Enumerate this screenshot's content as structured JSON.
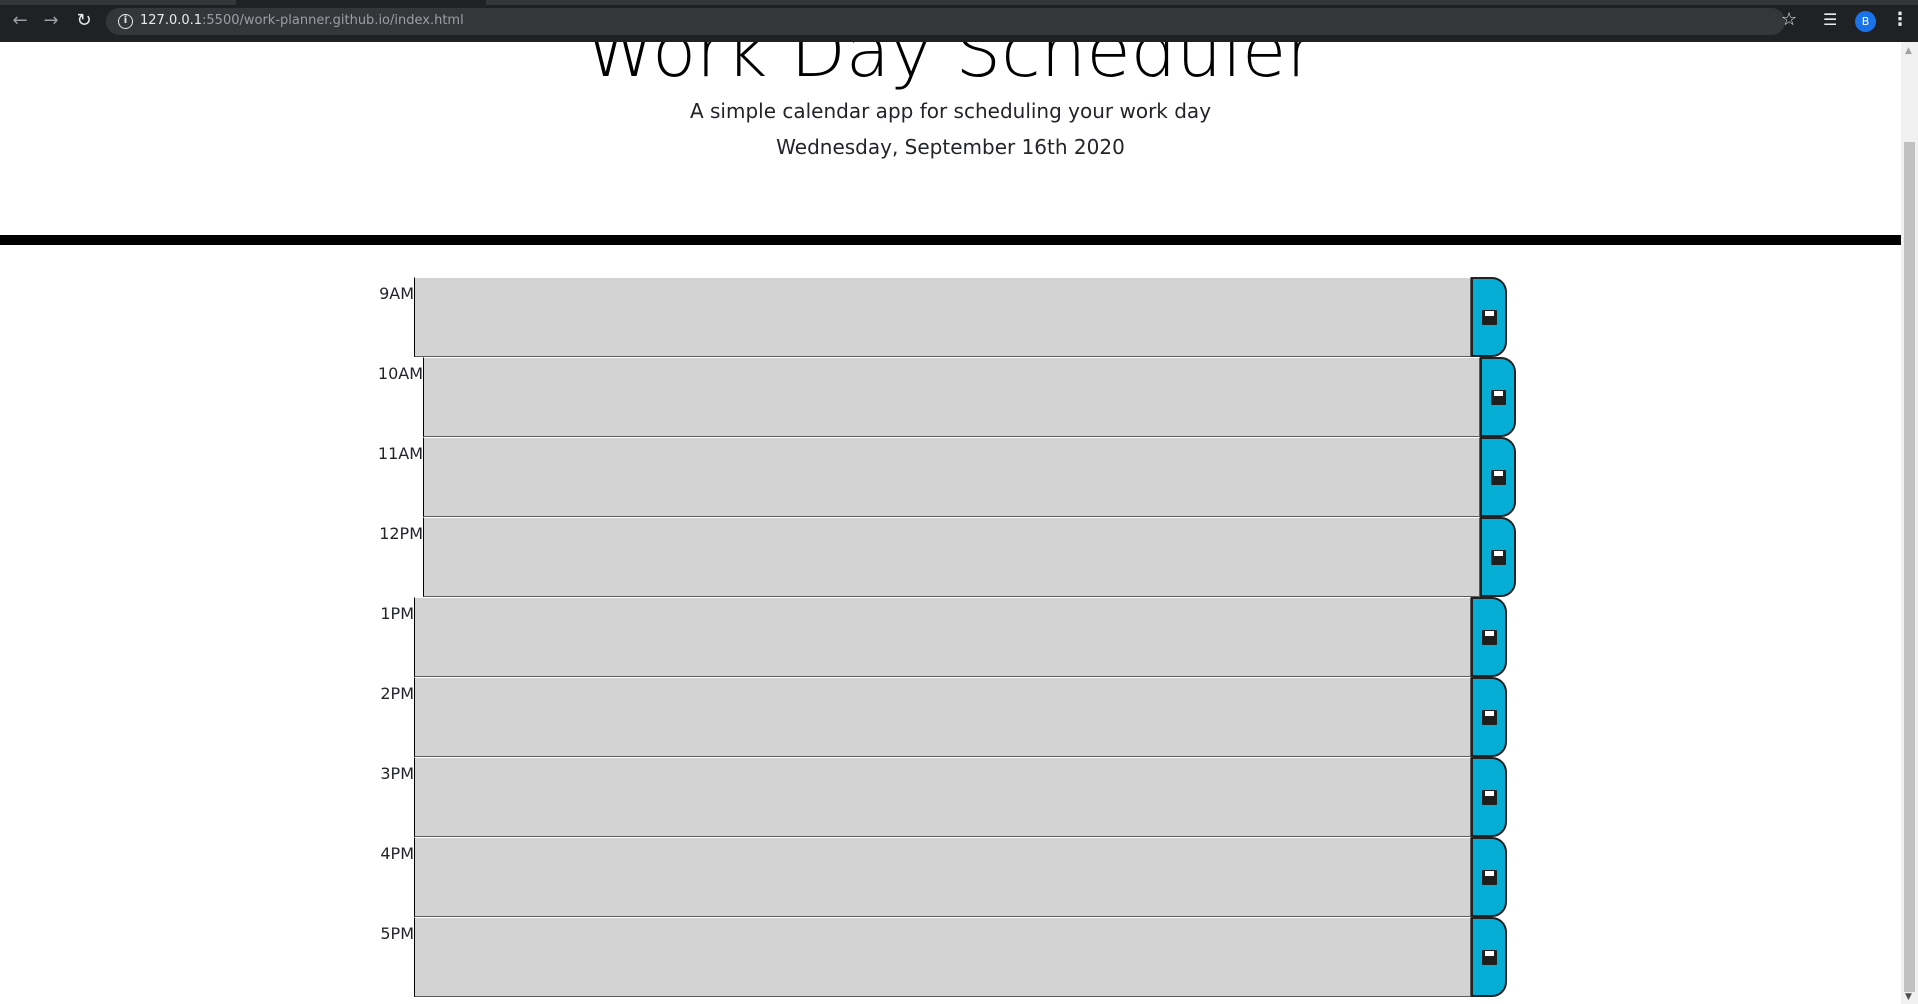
{
  "browser": {
    "url_host": "127.0.0.1",
    "url_rest": ":5500/work-planner.github.io/index.html",
    "avatar_letter": "B"
  },
  "header": {
    "title": "Work Day Scheduler",
    "lead": "A simple calendar app for scheduling your work day",
    "current_day": "Wednesday, September 16th 2020"
  },
  "colors": {
    "row_bg": "#d3d3d3",
    "save_button": "#06aed5",
    "divider": "#000000"
  },
  "rows": [
    {
      "hour": "9AM",
      "value": ""
    },
    {
      "hour": "10AM",
      "value": ""
    },
    {
      "hour": "11AM",
      "value": ""
    },
    {
      "hour": "12PM",
      "value": ""
    },
    {
      "hour": "1PM",
      "value": ""
    },
    {
      "hour": "2PM",
      "value": ""
    },
    {
      "hour": "3PM",
      "value": ""
    },
    {
      "hour": "4PM",
      "value": ""
    },
    {
      "hour": "5PM",
      "value": ""
    }
  ],
  "icons": {
    "save": "floppy-disk-icon"
  }
}
